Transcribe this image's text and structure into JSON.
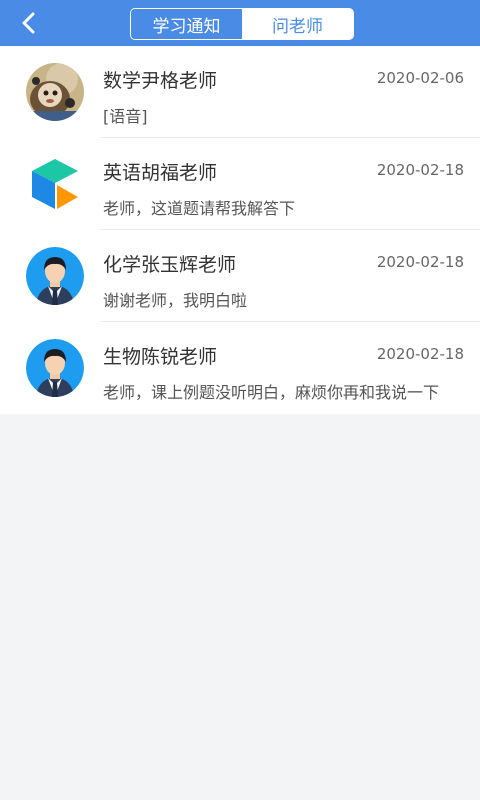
{
  "header": {
    "back_icon": "chevron-left-icon",
    "tabs": [
      {
        "label": "学习通知",
        "active": false
      },
      {
        "label": "问老师",
        "active": true
      }
    ]
  },
  "conversations": [
    {
      "name": "数学尹格老师",
      "date": "2020-02-06",
      "message": "[语音]",
      "avatar": "photo-avatar-icon"
    },
    {
      "name": "英语胡福老师",
      "date": "2020-02-18",
      "message": "老师，这道题请帮我解答下",
      "avatar": "cube-logo-icon"
    },
    {
      "name": "化学张玉辉老师",
      "date": "2020-02-18",
      "message": "谢谢老师，我明白啦",
      "avatar": "teacher-avatar-icon"
    },
    {
      "name": "生物陈锐老师",
      "date": "2020-02-18",
      "message": "老师，课上例题没听明白，麻烦你再和我说一下",
      "avatar": "teacher-avatar-icon"
    }
  ],
  "colors": {
    "header_bg": "#4a8be6",
    "page_bg": "#f3f4f6"
  }
}
